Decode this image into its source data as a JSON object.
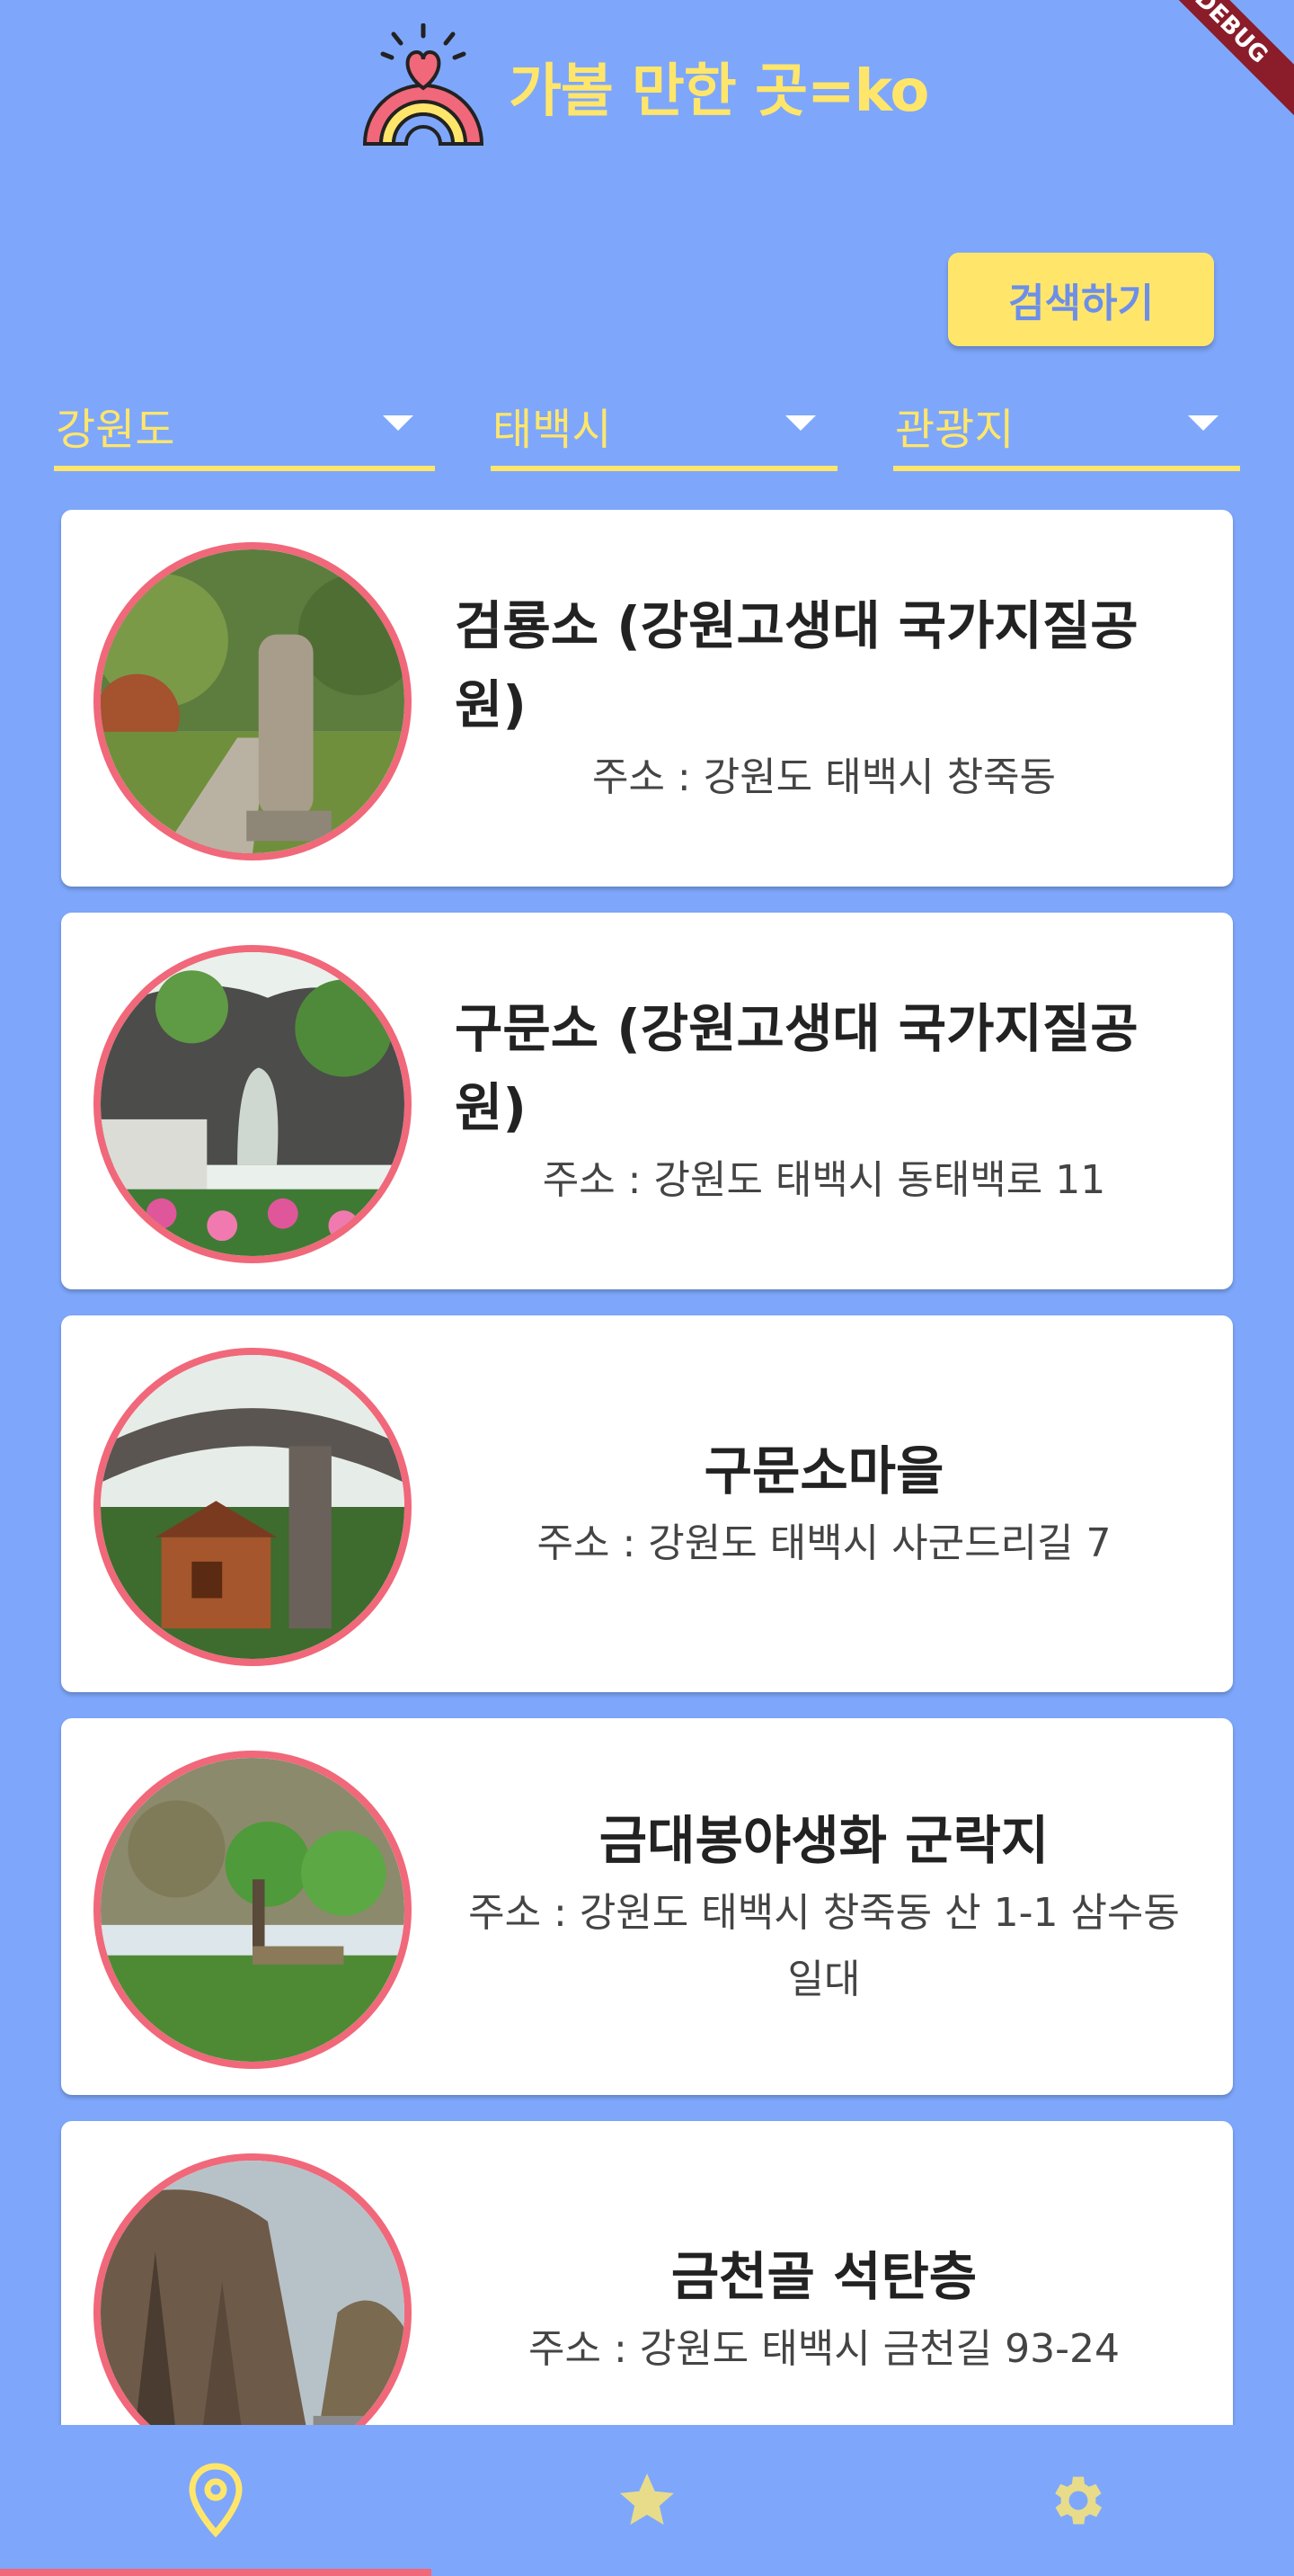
{
  "app": {
    "title": "가볼 만한 곳=ko",
    "debug_label": "DEBUG"
  },
  "search": {
    "button_label": "검색하기"
  },
  "filters": {
    "province": "강원도",
    "city": "태백시",
    "category": "관광지"
  },
  "places": [
    {
      "name": "검룡소 (강원고생대 국가지질공원)",
      "address": "주소 : 강원도 태백시 창죽동"
    },
    {
      "name": "구문소 (강원고생대 국가지질공원)",
      "address": "주소 : 강원도 태백시 동태백로 11"
    },
    {
      "name": "구문소마을",
      "address": "주소 : 강원도 태백시 사군드리길 7"
    },
    {
      "name": "금대봉야생화 군락지",
      "address": "주소 : 강원도 태백시 창죽동 산 1-1 삼수동 일대"
    },
    {
      "name": "금천골 석탄층",
      "address": "주소 : 강원도 태백시 금천길 93-24"
    }
  ],
  "nav": {
    "items": [
      {
        "icon": "location-pin-icon",
        "active": true
      },
      {
        "icon": "star-icon",
        "active": false
      },
      {
        "icon": "gear-icon",
        "active": false
      }
    ]
  },
  "colors": {
    "background": "#7ea7fb",
    "accent_yellow": "#ffe66b",
    "accent_pink": "#f0687a",
    "debug_ribbon": "#8b1c2a"
  }
}
